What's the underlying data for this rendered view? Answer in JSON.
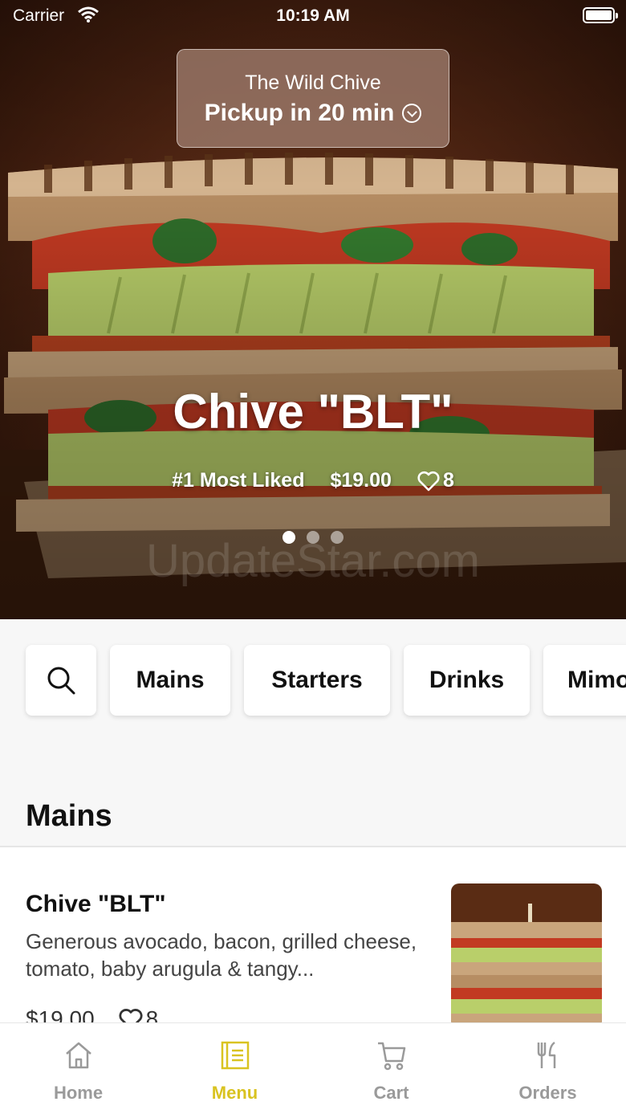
{
  "status_bar": {
    "carrier": "Carrier",
    "time": "10:19 AM"
  },
  "pickup": {
    "store_name": "The Wild Chive",
    "pickup_text": "Pickup in 20 min"
  },
  "hero": {
    "title": "Chive \"BLT\"",
    "badge": "#1 Most Liked",
    "price": "$19.00",
    "likes": "8",
    "carousel_pages": 3,
    "carousel_active": 1,
    "watermark": "UpdateStar.com"
  },
  "categories": {
    "search_icon": "search-icon",
    "items": [
      "Mains",
      "Starters",
      "Drinks",
      "Mimo"
    ]
  },
  "section": {
    "title": "Mains"
  },
  "menu_item": {
    "name": "Chive \"BLT\"",
    "description": "Generous avocado, bacon, grilled cheese, tomato, baby arugula & tangy...",
    "price": "$19.00",
    "likes": "8"
  },
  "tabbar": {
    "items": [
      {
        "label": "Home",
        "icon": "home-icon"
      },
      {
        "label": "Menu",
        "icon": "menu-icon"
      },
      {
        "label": "Cart",
        "icon": "cart-icon"
      },
      {
        "label": "Orders",
        "icon": "fork-knife-icon"
      }
    ],
    "active_index": 1
  },
  "colors": {
    "accent": "#d9c321",
    "inactive": "#9a9a9a"
  }
}
